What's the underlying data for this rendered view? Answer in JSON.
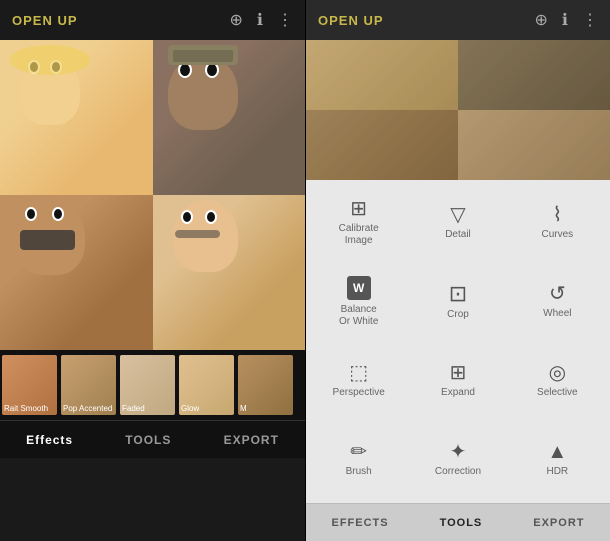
{
  "app": {
    "title": "OPEN UP"
  },
  "left_panel": {
    "title": "OPEN UP",
    "top_icons": [
      "layers-icon",
      "info-icon",
      "more-icon"
    ],
    "thumbnails": [
      {
        "label": "Rait Smooth"
      },
      {
        "label": "Pop Accented"
      },
      {
        "label": "Faded"
      },
      {
        "label": "Glow"
      },
      {
        "label": "M"
      }
    ],
    "bottom_nav": [
      {
        "label": "Effects",
        "active": true
      },
      {
        "label": "TOOLS"
      },
      {
        "label": "EXPORT"
      }
    ]
  },
  "right_panel": {
    "title": "OPEN UP",
    "top_icons": [
      "layers-icon",
      "info-icon",
      "more-icon"
    ],
    "tools": [
      {
        "icon": "⊞",
        "label": "Calibrate\nImage",
        "symbol": "sliders"
      },
      {
        "icon": "▽",
        "label": "Detail",
        "symbol": "triangle-down"
      },
      {
        "icon": "⌇",
        "label": "Curves",
        "symbol": "curves"
      },
      {
        "icon": "W",
        "label": "Balance\nOr White",
        "symbol": "wb"
      },
      {
        "icon": "⊡",
        "label": "Crop",
        "symbol": "crop"
      },
      {
        "icon": "↺",
        "label": "Wheel",
        "symbol": "wheel"
      },
      {
        "icon": "⊡",
        "label": "Perspective",
        "symbol": "perspective"
      },
      {
        "icon": "⊞",
        "label": "Expand",
        "symbol": "expand"
      },
      {
        "icon": "◎",
        "label": "Selective",
        "symbol": "selective"
      },
      {
        "icon": "✏",
        "label": "Brush",
        "symbol": "brush"
      },
      {
        "icon": "✦",
        "label": "Correction",
        "symbol": "correction"
      },
      {
        "icon": "▲",
        "label": "HDR",
        "symbol": "hdr"
      }
    ],
    "bottom_nav": [
      {
        "label": "EFFECTS"
      },
      {
        "label": "TOOLS",
        "active": true
      },
      {
        "label": "EXPORT"
      }
    ]
  }
}
